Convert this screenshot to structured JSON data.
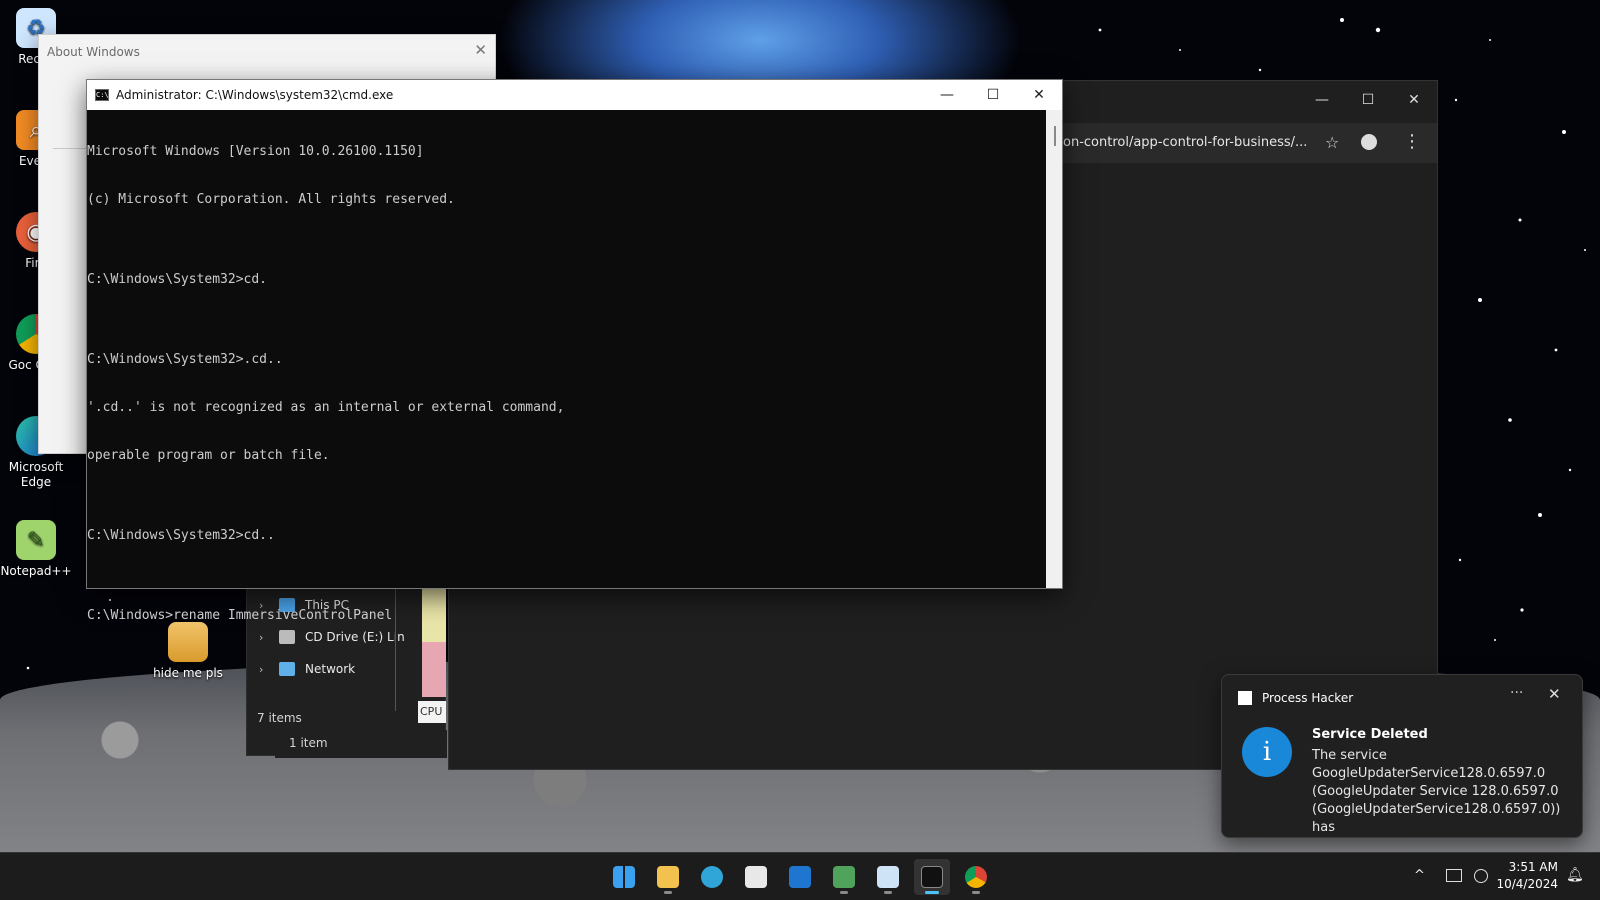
{
  "desktop": {
    "icons": [
      {
        "label": "Recyc",
        "icon": "recycle-bin-icon"
      },
      {
        "label": "Every",
        "icon": "everything-icon"
      },
      {
        "label": "Fire",
        "icon": "firefox-icon"
      },
      {
        "label": "Goc Chro",
        "icon": "chrome-icon"
      },
      {
        "label": "Microsoft Edge",
        "icon": "edge-icon"
      },
      {
        "label": "Notepad++",
        "icon": "notepadpp-icon"
      },
      {
        "label": "hide me pls",
        "icon": "folder-icon"
      }
    ]
  },
  "about": {
    "title": "About Windows",
    "close": "✕"
  },
  "explorer": {
    "items": [
      {
        "label": "This PC",
        "icon": "this-pc-icon"
      },
      {
        "label": "CD Drive (E:) Lin",
        "icon": "cd-drive-icon"
      },
      {
        "label": "Network",
        "icon": "network-icon"
      }
    ],
    "status": "7 items",
    "status2": "1 item",
    "graph_label": "CPU"
  },
  "browser": {
    "url": "on-control/app-control-for-business/...",
    "minimize": "—",
    "maximize": "☐",
    "close": "✕",
    "star": "☆",
    "more": "⋮"
  },
  "cmd": {
    "title": "Administrator: C:\\Windows\\system32\\cmd.exe",
    "minimize": "—",
    "maximize": "☐",
    "close": "✕",
    "lines": [
      "Microsoft Windows [Version 10.0.26100.1150]",
      "(c) Microsoft Corporation. All rights reserved.",
      "",
      "C:\\Windows\\System32>cd.",
      "",
      "C:\\Windows\\System32>.cd..",
      "'.cd..' is not recognized as an internal or external command,",
      "operable program or batch file.",
      "",
      "C:\\Windows\\System32>cd..",
      "",
      "C:\\Windows>rename ImmersiveControlPanel"
    ]
  },
  "toast": {
    "app_name": "Process Hacker",
    "more": "···",
    "close": "✕",
    "icon": "i",
    "heading": "Service Deleted",
    "body": "The service GoogleUpdaterService128.0.6597.0 (GoogleUpdater Service 128.0.6597.0 (GoogleUpdaterService128.0.6597.0)) has"
  },
  "taskbar": {
    "apps": [
      {
        "name": "start-button",
        "color": "#3aa0f0"
      },
      {
        "name": "file-explorer-icon",
        "color": "#f2c14e"
      },
      {
        "name": "edge-taskbar-icon",
        "color": "#2fa5d8"
      },
      {
        "name": "store-icon",
        "color": "#e8e8e8"
      },
      {
        "name": "outlook-icon",
        "color": "#1f76d0"
      },
      {
        "name": "task-manager-icon",
        "color": "#4fa35a"
      },
      {
        "name": "notepad-window-icon",
        "color": "#cfe3f7"
      },
      {
        "name": "terminal-icon",
        "color": "#111111"
      },
      {
        "name": "chrome-taskbar-icon",
        "color": "#e84b3c"
      }
    ],
    "tray_chevron": "^",
    "time": "3:51 AM",
    "date": "10/4/2024"
  }
}
